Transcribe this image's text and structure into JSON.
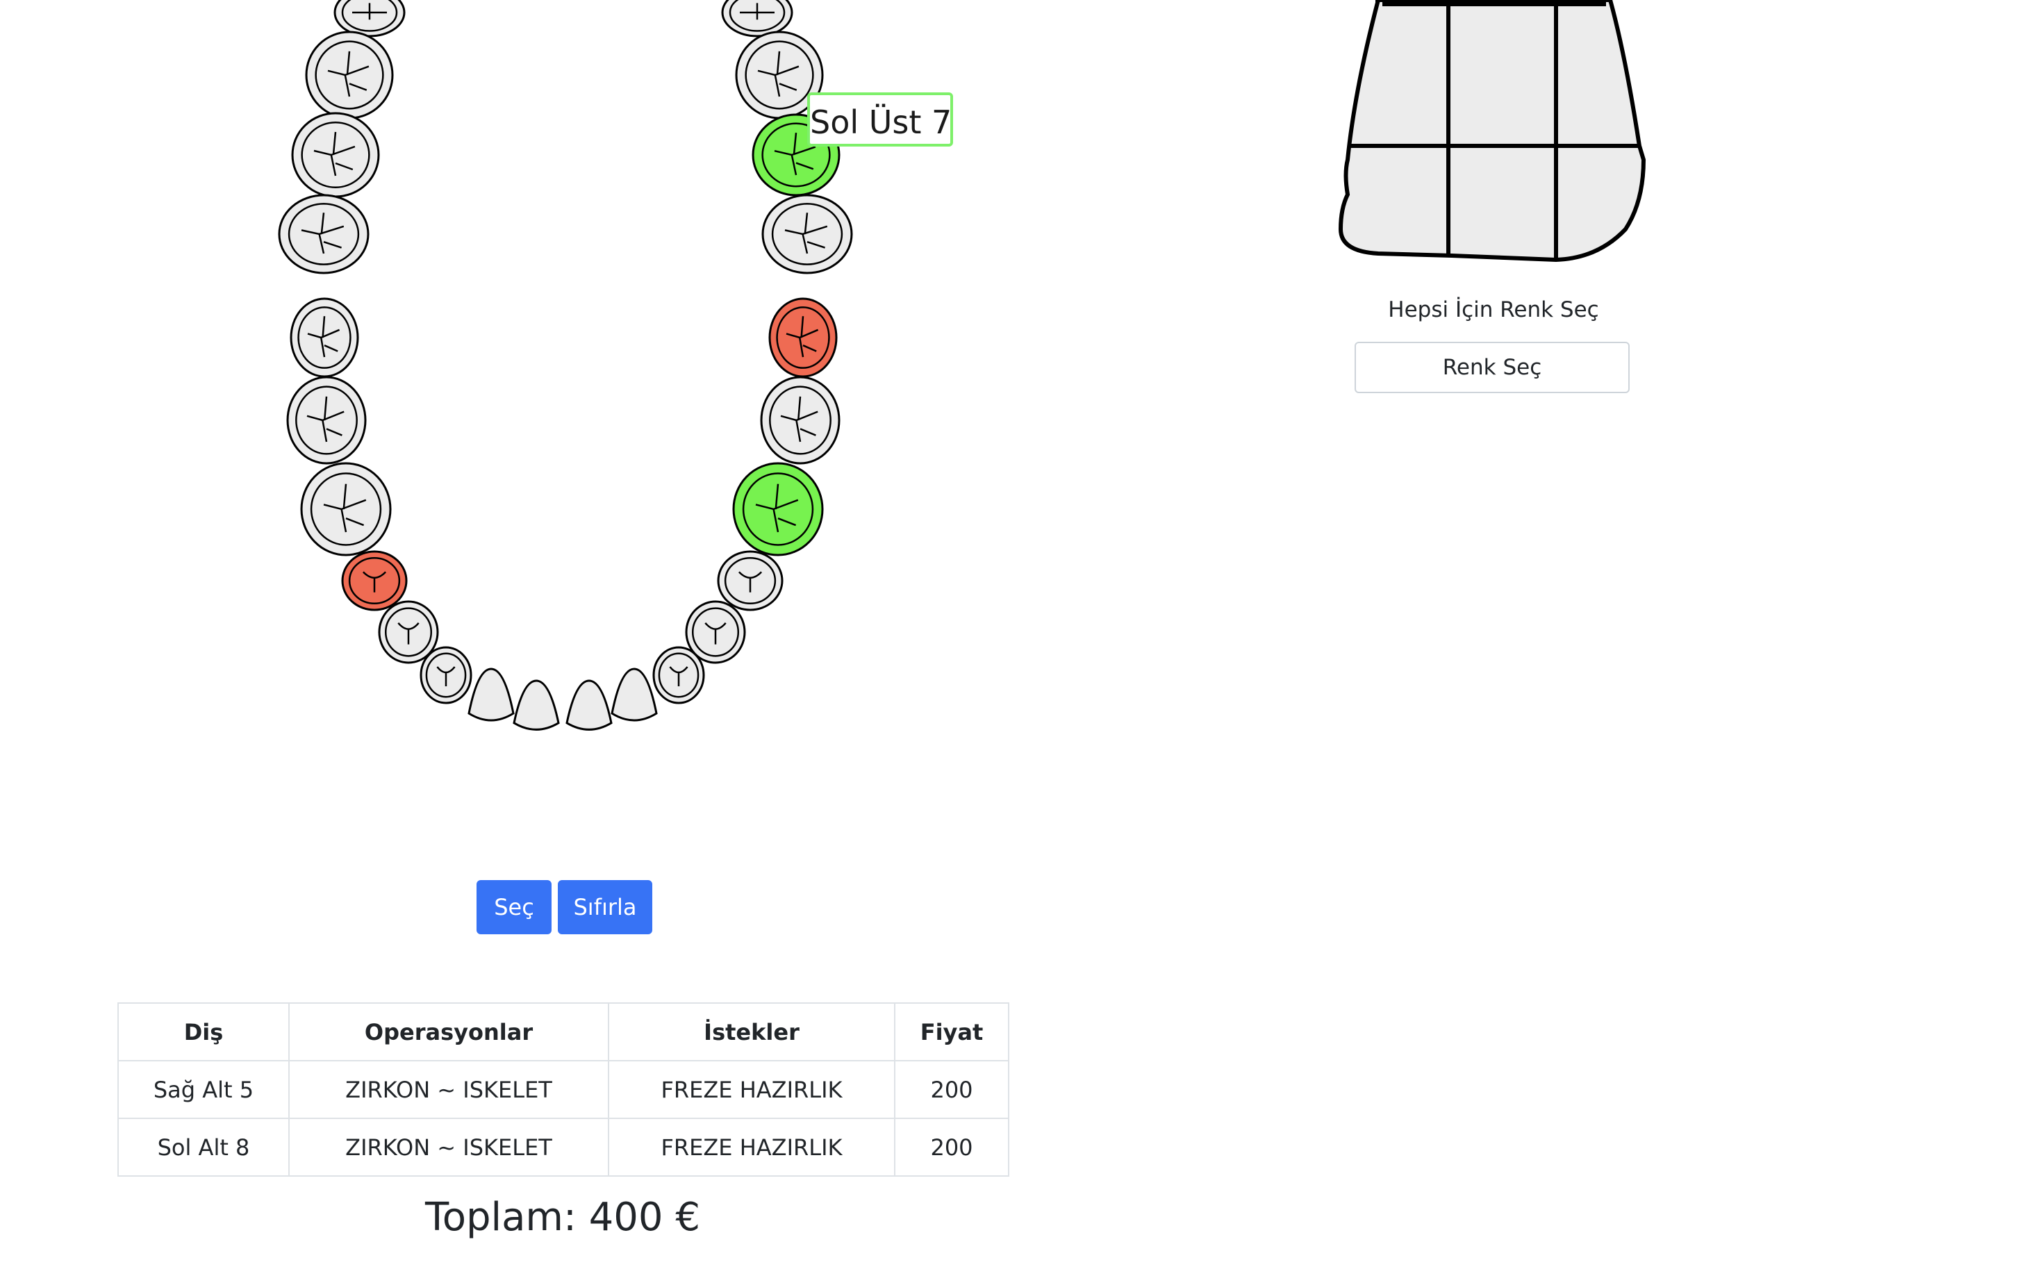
{
  "tooltip": {
    "text": "Sol Üst 7"
  },
  "colors": {
    "tooth_default": "#ececec",
    "tooth_selected_green": "#77f24f",
    "tooth_marked_red": "#ef6b53",
    "tooltip_border": "#7ef06a",
    "primary_button": "#3773f5",
    "table_border": "#dee2e6"
  },
  "teeth": [
    {
      "name": "tooth-upper-right-partial",
      "state": "default"
    },
    {
      "name": "tooth-upper-right-2",
      "state": "default"
    },
    {
      "name": "tooth-upper-right-3",
      "state": "default"
    },
    {
      "name": "tooth-upper-right-4",
      "state": "default"
    },
    {
      "name": "tooth-upper-left-partial",
      "state": "default"
    },
    {
      "name": "tooth-upper-left-2",
      "state": "default"
    },
    {
      "name": "tooth-sol-ust-7",
      "state": "selected"
    },
    {
      "name": "tooth-upper-left-4",
      "state": "default"
    },
    {
      "name": "tooth-lower-right-8",
      "state": "default"
    },
    {
      "name": "tooth-lower-right-7",
      "state": "default"
    },
    {
      "name": "tooth-lower-right-6",
      "state": "default"
    },
    {
      "name": "tooth-lower-right-5",
      "state": "marked"
    },
    {
      "name": "tooth-lower-right-4",
      "state": "default"
    },
    {
      "name": "tooth-lower-right-3",
      "state": "default"
    },
    {
      "name": "tooth-lower-right-2",
      "state": "default"
    },
    {
      "name": "tooth-lower-right-1",
      "state": "default"
    },
    {
      "name": "tooth-lower-left-1",
      "state": "default"
    },
    {
      "name": "tooth-lower-left-2",
      "state": "default"
    },
    {
      "name": "tooth-lower-left-3",
      "state": "default"
    },
    {
      "name": "tooth-lower-left-4",
      "state": "default"
    },
    {
      "name": "tooth-lower-left-5",
      "state": "default"
    },
    {
      "name": "tooth-lower-left-6",
      "state": "selected"
    },
    {
      "name": "tooth-lower-left-7",
      "state": "default"
    },
    {
      "name": "tooth-lower-left-8",
      "state": "marked"
    }
  ],
  "buttons": {
    "select": "Seç",
    "reset": "Sıfırla"
  },
  "table": {
    "headers": [
      "Diş",
      "Operasyonlar",
      "İstekler",
      "Fiyat"
    ],
    "rows": [
      [
        "Sağ Alt 5",
        "ZIRKON ~ ISKELET",
        "FREZE HAZIRLIK",
        "200"
      ],
      [
        "Sol Alt 8",
        "ZIRKON ~ ISKELET",
        "FREZE HAZIRLIK",
        "200"
      ]
    ]
  },
  "total": "Toplam: 400 €",
  "shade": {
    "label": "Hepsi İçin Renk Seç",
    "button": "Renk Seç"
  }
}
